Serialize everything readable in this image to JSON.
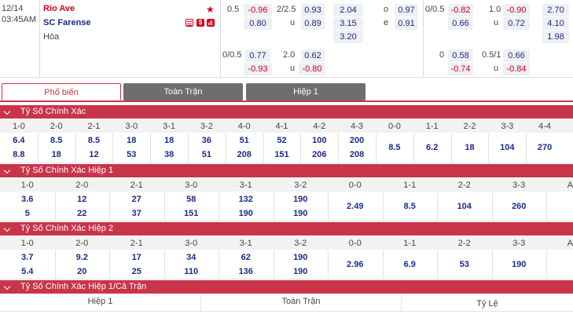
{
  "match": {
    "date": "12/14",
    "time": "03:45AM",
    "home": "Rio Ave",
    "away": "SC Farense",
    "draw_label": "Hòa",
    "icon_labels": [
      "$",
      "S"
    ]
  },
  "odds": {
    "row1": {
      "hcap": "0.5",
      "hcap_home": "-0.96",
      "ou_line": "2/2.5",
      "ou_over": "0.93",
      "x1": "2.04",
      "o_label": "o",
      "oe_o": "0.97",
      "h1_hcap": "0/0.5",
      "h1_home": "-0.82",
      "h1_ou": "1.0",
      "h1_over": "-0.90",
      "h1_x": "2.70"
    },
    "row2": {
      "hcap_away": "0.80",
      "u_label": "u",
      "ou_under": "0.89",
      "x2": "3.15",
      "e_label": "e",
      "oe_e": "0.91",
      "h1_away": "0.66",
      "h1_u_label": "u",
      "h1_under": "0.72",
      "h1_x2": "4.10"
    },
    "row3": {
      "xdraw": "3.20",
      "h1_draw": "1.98"
    },
    "row4": {
      "hcap": "0/0.5",
      "hcap_home": "0.77",
      "ou_line": "2.0",
      "ou_over": "0.62",
      "h1_hcap": "0",
      "h1_home": "0.58",
      "h1_ou": "0.5/1",
      "h1_over": "0.66"
    },
    "row5": {
      "hcap_away": "-0.93",
      "u_label": "u",
      "ou_under": "-0.80",
      "h1_away": "-0.74",
      "h1_u_label": "u",
      "h1_under": "-0.84"
    }
  },
  "tabs": [
    "Phổ biến",
    "Toàn Trận",
    "Hiệp 1"
  ],
  "sections": {
    "s1": {
      "title": "Tỷ Số Chính Xác",
      "cols": [
        "1-0",
        "2-0",
        "2-1",
        "3-0",
        "3-1",
        "3-2",
        "4-0",
        "4-1",
        "4-2",
        "4-3",
        "0-0",
        "1-1",
        "2-2",
        "3-3",
        "4-4"
      ],
      "home": [
        "6.4",
        "8.5",
        "8.5",
        "18",
        "18",
        "36",
        "51",
        "52",
        "100",
        "200"
      ],
      "away": [
        "8.8",
        "18",
        "12",
        "53",
        "38",
        "51",
        "208",
        "151",
        "206",
        "208"
      ],
      "mid": [
        "8.5",
        "6.2",
        "18",
        "104",
        "270"
      ]
    },
    "s2": {
      "title": "Tỷ Số Chính Xác Hiệp 1",
      "cols": [
        "1-0",
        "2-0",
        "2-1",
        "3-0",
        "3-1",
        "3-2",
        "0-0",
        "1-1",
        "2-2",
        "3-3",
        "AO"
      ],
      "home": [
        "3.6",
        "12",
        "27",
        "58",
        "132",
        "190"
      ],
      "away": [
        "5",
        "22",
        "37",
        "151",
        "190",
        "190"
      ],
      "mid": [
        "2.49",
        "8.5",
        "104",
        "260"
      ]
    },
    "s3": {
      "title": "Tỷ Số Chính Xác Hiệp 2",
      "cols": [
        "1-0",
        "2-0",
        "2-1",
        "3-0",
        "3-1",
        "3-2",
        "0-0",
        "1-1",
        "2-2",
        "3-3",
        "AO"
      ],
      "home": [
        "3.7",
        "9.2",
        "17",
        "34",
        "62",
        "190"
      ],
      "away": [
        "5.4",
        "20",
        "25",
        "110",
        "136",
        "190"
      ],
      "mid": [
        "2.96",
        "6.9",
        "53",
        "190"
      ]
    },
    "s4": {
      "title": "Tỷ Số Chính Xác Hiệp 1/Cả Trận",
      "cols": [
        "Hiệp 1",
        "Toàn Trận",
        "Tỷ Lệ"
      ]
    }
  },
  "colors": {
    "accent": "#c8354a",
    "odds_blue": "#1a2b8a",
    "odds_red": "#d0021b",
    "tab_active": "#c8354a",
    "tab_inactive": "#6e6e6e"
  }
}
